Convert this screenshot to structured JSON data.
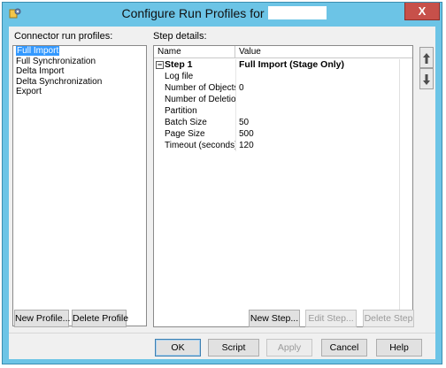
{
  "window": {
    "title": "Configure Run Profiles for",
    "close_glyph": "X",
    "icon": "app-gear-icon"
  },
  "left": {
    "label": "Connector run profiles:",
    "profiles": [
      {
        "label": "Full Import",
        "selected": true
      },
      {
        "label": "Full Synchronization",
        "selected": false
      },
      {
        "label": "Delta Import",
        "selected": false
      },
      {
        "label": "Delta Synchronization",
        "selected": false
      },
      {
        "label": "Export",
        "selected": false
      }
    ],
    "new_profile": "New Profile...",
    "delete_profile": "Delete Profile"
  },
  "details": {
    "label": "Step details:",
    "columns": [
      "Name",
      "Value"
    ],
    "step": {
      "expander": "−",
      "name": "Step 1",
      "value": "Full Import (Stage Only)"
    },
    "rows": [
      {
        "name": "Log file",
        "value": ""
      },
      {
        "name": "Number of Objects",
        "value": "0"
      },
      {
        "name": "Number of Deletions",
        "value": ""
      },
      {
        "name": "Partition",
        "value": ""
      },
      {
        "name": "Batch Size",
        "value": "50"
      },
      {
        "name": "Page Size",
        "value": "500"
      },
      {
        "name": "Timeout (seconds)",
        "value": "120"
      }
    ],
    "move_up_icon": "arrow-up-icon",
    "move_down_icon": "arrow-down-icon",
    "new_step": "New Step...",
    "edit_step": "Edit Step...",
    "delete_step": "Delete Step"
  },
  "footer": {
    "ok": "OK",
    "script": "Script",
    "apply": "Apply",
    "cancel": "Cancel",
    "help": "Help"
  },
  "colors": {
    "frame": "#6cc4e6",
    "close": "#c7504a",
    "selection": "#3399ff",
    "client": "#f0f0f0"
  }
}
